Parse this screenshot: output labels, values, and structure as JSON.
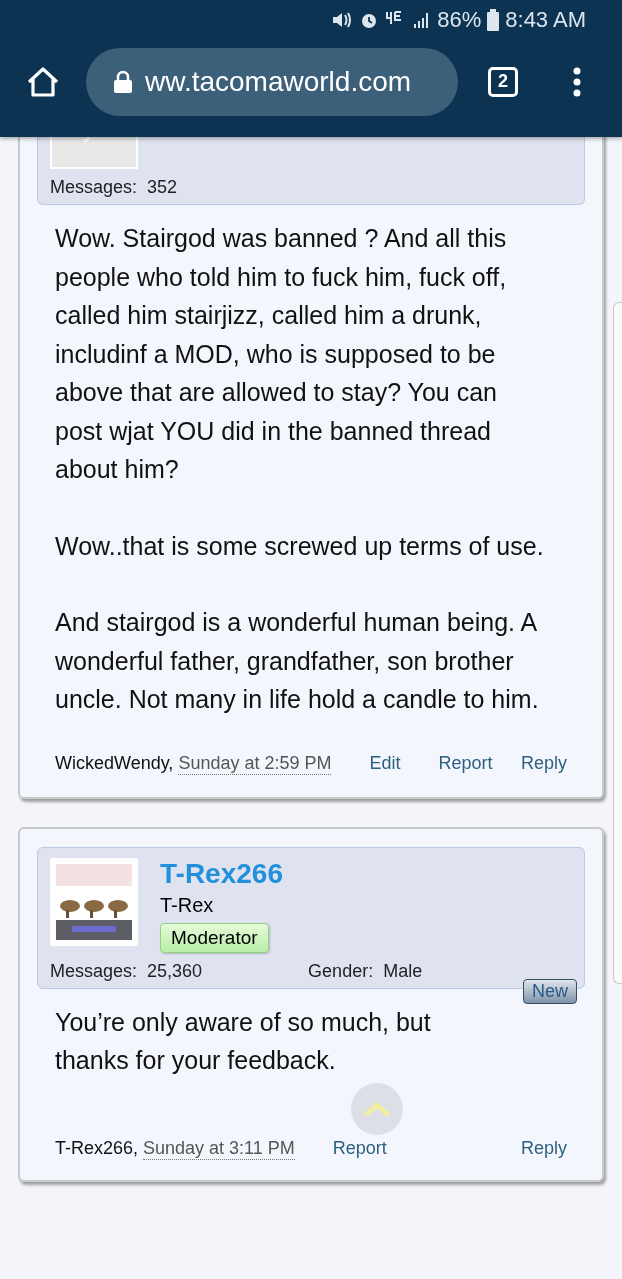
{
  "status_bar": {
    "battery": "86%",
    "time": "8:43 AM"
  },
  "browser": {
    "url": "ww.tacomaworld.com",
    "tab_count": "2"
  },
  "posts": [
    {
      "kind": "own",
      "author": {
        "messages_label": "Messages:",
        "messages": "352"
      },
      "paragraphs": [
        "Wow. Stairgod was banned ? And all this people who told him to fuck him, fuck off, called him stairjizz, called him a drunk, includinf a MOD, who is supposed to be above that are allowed to stay? You can post wjat YOU did in the banned thread about him?",
        "Wow..that is some screwed up terms of use.",
        "And stairgod is a wonderful human being. A wonderful father, grandfather, son brother uncle. Not many in life hold a candle to him."
      ],
      "footer": {
        "user": "WickedWendy,",
        "date": "Sunday at 2:59 PM",
        "actions": [
          "Edit",
          "Report"
        ],
        "reply": "Reply"
      }
    },
    {
      "kind": "other",
      "author": {
        "name": "T-Rex266",
        "title": "T-Rex",
        "badge": "Moderator",
        "messages_label": "Messages:",
        "messages": "25,360",
        "gender_label": "Gender:",
        "gender": "Male"
      },
      "new_tag": "New",
      "paragraphs": [
        "You’re only aware of so much, but thanks for your feedback."
      ],
      "footer": {
        "user": "T-Rex266,",
        "date": "Sunday at 3:11 PM",
        "actions": [
          "Report"
        ],
        "reply": "Reply"
      }
    }
  ]
}
